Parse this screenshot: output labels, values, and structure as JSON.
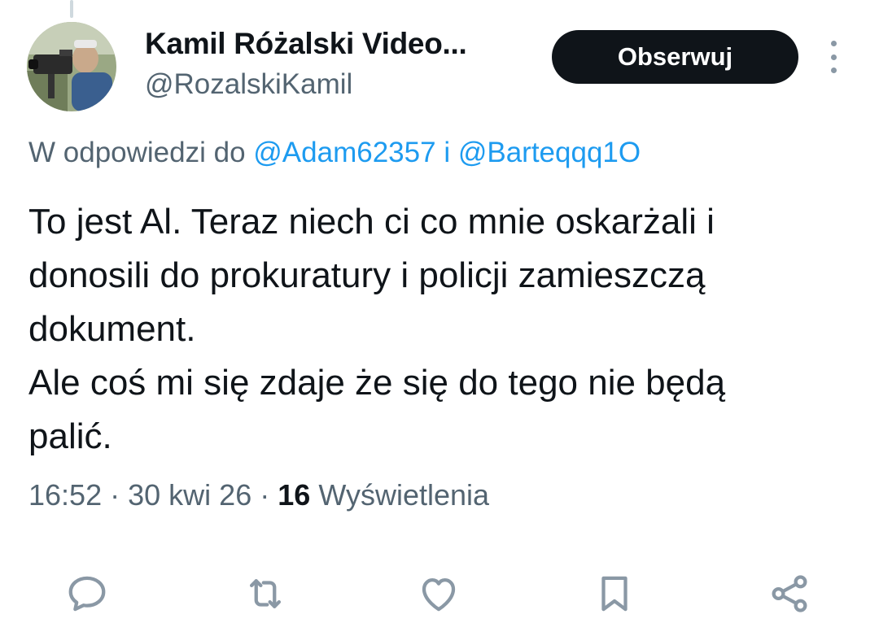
{
  "author": {
    "name": "Kamil Różalski Video...",
    "handle": "@RozalskiKamil",
    "avatar_icon": "avatar-photo-cameraman"
  },
  "follow_button_label": "Obserwuj",
  "reply_context": {
    "prefix": "W odpowiedzi do",
    "mentions": [
      "@Adam62357",
      "@Barteqqq1O"
    ],
    "joiner": "i"
  },
  "tweet": {
    "text": "To jest Al.  Teraz niech ci co mnie oskarżali i\ndonosili do prokuratury i policji zamieszczą\ndokument.\nAle coś mi się zdaje że się do tego nie będą\npalić."
  },
  "meta": {
    "time": "16:52",
    "separator": "·",
    "date": "30 kwi 26",
    "views_count": "16",
    "views_label": "Wyświetlenia"
  },
  "actions": {
    "icons": [
      "reply-icon",
      "retweet-icon",
      "like-icon",
      "bookmark-icon",
      "share-icon"
    ]
  },
  "colors": {
    "accent": "#1d9bf0",
    "secondary_text": "#536471",
    "primary_text": "#0f1419",
    "button_bg": "#0f1419",
    "icon_gray": "#8a98a5"
  }
}
